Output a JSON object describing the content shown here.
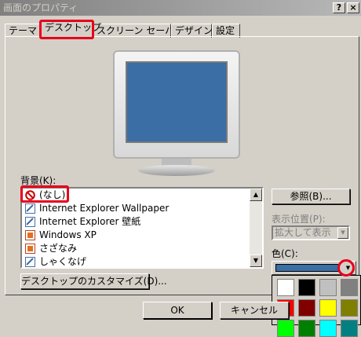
{
  "window": {
    "title": "画面のプロパティ",
    "help_label": "?",
    "close_label": "×"
  },
  "tabs": [
    {
      "label": "テーマ"
    },
    {
      "label": "デスクトップ",
      "active": true
    },
    {
      "label": "スクリーン セーバー"
    },
    {
      "label": "デザイン"
    },
    {
      "label": "設定"
    }
  ],
  "background": {
    "label": "背景(K):",
    "items": [
      {
        "label": "(なし)",
        "icon": "no-entry-icon",
        "selected": true
      },
      {
        "label": "Internet Explorer Wallpaper",
        "icon": "image-file-icon"
      },
      {
        "label": "Internet Explorer 壁紙",
        "icon": "image-file-icon"
      },
      {
        "label": "Windows XP",
        "icon": "image-file-icon"
      },
      {
        "label": "さざなみ",
        "icon": "image-file-icon"
      },
      {
        "label": "しゃくなげ",
        "icon": "image-file-icon"
      }
    ]
  },
  "browse_label": "参照(B)...",
  "position": {
    "label": "表示位置(P):",
    "value": "拡大して表示"
  },
  "color": {
    "label": "色(C):",
    "current": "#3a6ea5",
    "palette": [
      "#ffffff",
      "#000000",
      "#c0c0c0",
      "#808080",
      "#ff0000",
      "#800000",
      "#ffff00",
      "#808000",
      "#00ff00",
      "#008000",
      "#00ffff",
      "#008080"
    ]
  },
  "customize_label": "デスクトップのカスタマイズ(D)...",
  "ok_label": "OK",
  "cancel_label": "キャンセル",
  "highlight_color": "#e8001c"
}
